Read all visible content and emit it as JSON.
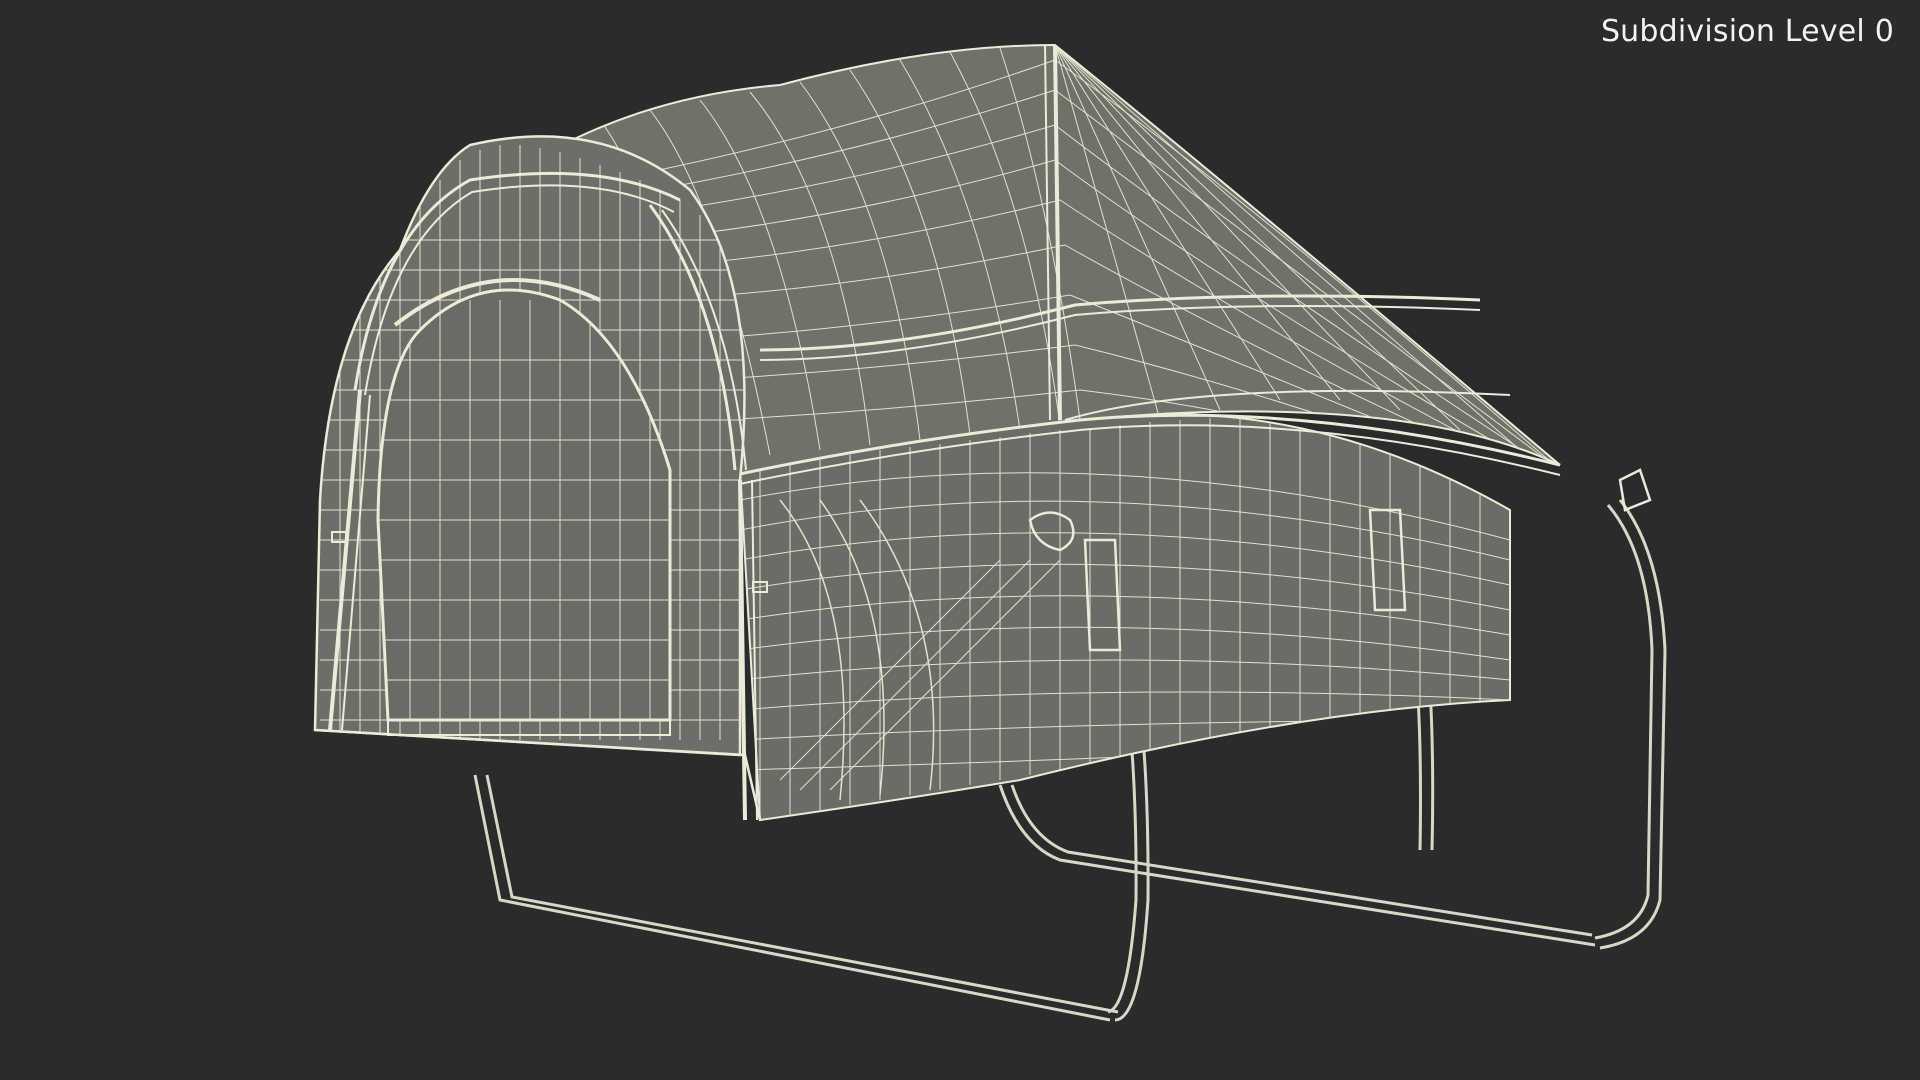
{
  "viewport": {
    "subdivision_label": "Subdivision Level 0",
    "background_color": "#2b2b2b",
    "mesh_fill_color": "#6f7069",
    "wire_color": "#ecead8"
  },
  "model": {
    "icon": "tent-wireframe-model"
  }
}
